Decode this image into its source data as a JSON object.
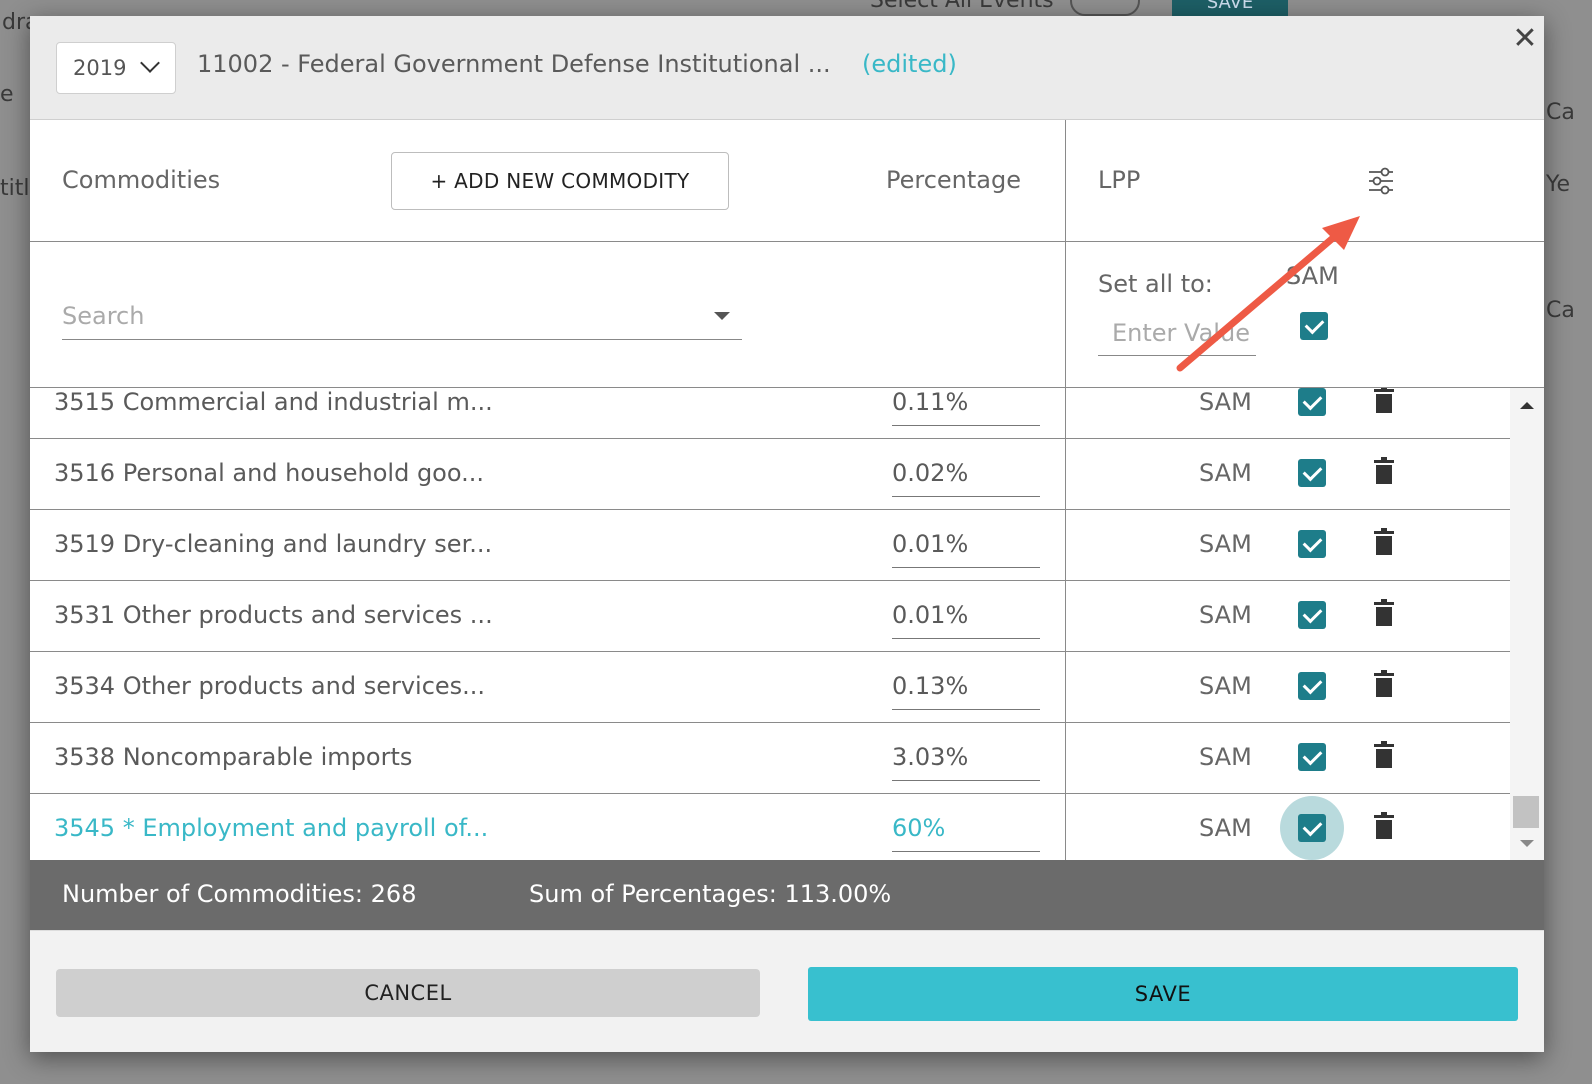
{
  "background": {
    "top_labels": [
      "Select All Events",
      "SAVE"
    ],
    "side_labels": [
      "dra",
      "e",
      "titl",
      "Ca",
      "Ye",
      "Ca"
    ]
  },
  "dialog": {
    "year": "2019",
    "title": "11002 - Federal Government Defense Institutional ...",
    "edited": "(edited)",
    "close_icon": "close-icon"
  },
  "header": {
    "commodities_label": "Commodities",
    "add_button": "+ ADD NEW COMMODITY",
    "percentage_label": "Percentage",
    "lpp_label": "LPP",
    "filter_icon": "sliders-icon"
  },
  "filter": {
    "search_placeholder": "Search",
    "set_all_label": "Set all to:",
    "set_all_placeholder": "Enter Value",
    "sam_header": "SAM",
    "sam_all_checked": true
  },
  "rows": [
    {
      "name": "3515 Commercial and industrial m...",
      "percentage": "0.11%",
      "lpp": "SAM",
      "checked": true
    },
    {
      "name": "3516 Personal and household goo...",
      "percentage": "0.02%",
      "lpp": "SAM",
      "checked": true
    },
    {
      "name": "3519 Dry-cleaning and laundry ser...",
      "percentage": "0.01%",
      "lpp": "SAM",
      "checked": true
    },
    {
      "name": "3531 Other products and services ...",
      "percentage": "0.01%",
      "lpp": "SAM",
      "checked": true
    },
    {
      "name": "3534 Other products and services...",
      "percentage": "0.13%",
      "lpp": "SAM",
      "checked": true
    },
    {
      "name": "3538 Noncomparable imports",
      "percentage": "3.03%",
      "lpp": "SAM",
      "checked": true
    },
    {
      "name": "3545 * Employment and payroll of...",
      "percentage": "60%",
      "lpp": "SAM",
      "checked": true,
      "selected": true
    }
  ],
  "summary": {
    "count_text": "Number of Commodities: 268",
    "sum_text": "Sum of Percentages: 113.00%"
  },
  "footer": {
    "cancel": "CANCEL",
    "save": "SAVE"
  },
  "colors": {
    "accent": "#39b8c7",
    "checkbox": "#1e7d8a",
    "save_button": "#38c0cf",
    "summary_bar": "#6b6b6b",
    "annotation_arrow": "#ee5a45"
  }
}
